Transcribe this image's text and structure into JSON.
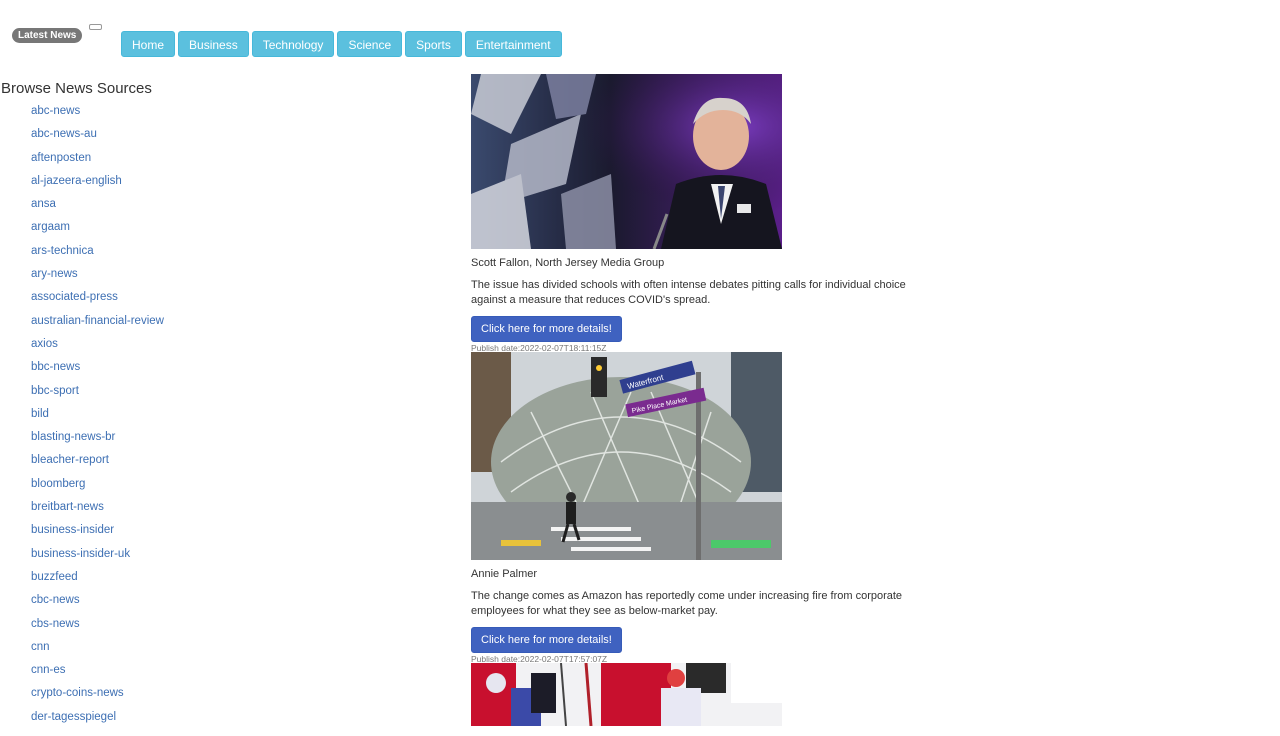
{
  "header": {
    "badge": "Latest News",
    "nav": [
      "Home",
      "Business",
      "Technology",
      "Science",
      "Sports",
      "Entertainment"
    ]
  },
  "sidebar": {
    "title": "Browse News Sources",
    "sources": [
      "abc-news",
      "abc-news-au",
      "aftenposten",
      "al-jazeera-english",
      "ansa",
      "argaam",
      "ars-technica",
      "ary-news",
      "associated-press",
      "australian-financial-review",
      "axios",
      "bbc-news",
      "bbc-sport",
      "bild",
      "blasting-news-br",
      "bleacher-report",
      "bloomberg",
      "breitbart-news",
      "business-insider",
      "business-insider-uk",
      "buzzfeed",
      "cbc-news",
      "cbs-news",
      "cnn",
      "cnn-es",
      "crypto-coins-news",
      "der-tagesspiegel"
    ]
  },
  "articles": [
    {
      "author": "Scott Fallon, North Jersey Media Group",
      "description": "The issue has divided schools with often intense debates pitting calls for individual choice against a measure that reduces COVID's spread.",
      "button_label": "Click here for more details!",
      "publish_date": "Publish date:2022-02-07T18:11:15Z"
    },
    {
      "author": "Annie Palmer",
      "description": "The change comes as Amazon has reportedly come under increasing fire from corporate employees for what they see as below-market pay.",
      "button_label": "Click here for more details!",
      "publish_date": "Publish date:2022-02-07T17:57:07Z"
    }
  ],
  "signs": {
    "waterfront": "Waterfront",
    "pike": "Pike Place Market"
  }
}
